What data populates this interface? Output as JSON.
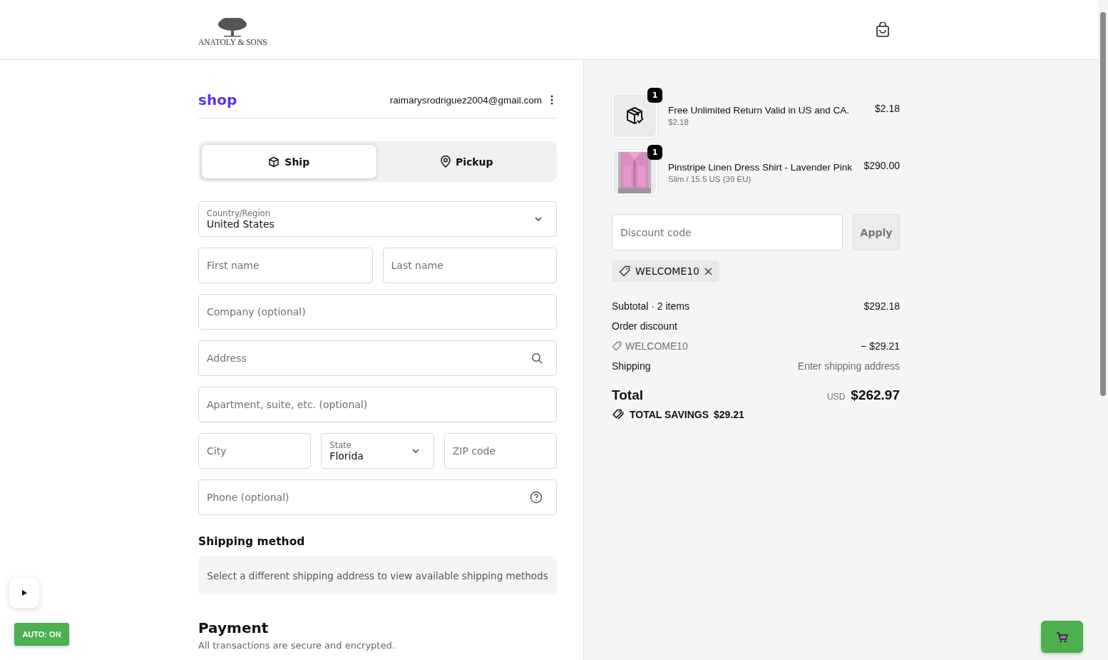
{
  "header": {
    "brand": "ANATOLY & SONS"
  },
  "account": {
    "logo": "shop",
    "email": "raimarysrodriguez2004@gmail.com"
  },
  "delivery_tabs": [
    {
      "label": "Ship",
      "kind": "ship",
      "selected": true
    },
    {
      "label": "Pickup",
      "kind": "pickup",
      "selected": false
    }
  ],
  "form_rows": [
    [
      {
        "kind": "select",
        "label": "Country/Region",
        "value": "United States"
      }
    ],
    [
      {
        "kind": "text",
        "placeholder": "First name"
      },
      {
        "kind": "text",
        "placeholder": "Last name"
      }
    ],
    [
      {
        "kind": "text",
        "placeholder": "Company (optional)"
      }
    ],
    [
      {
        "kind": "search",
        "placeholder": "Address"
      }
    ],
    [
      {
        "kind": "text",
        "placeholder": "Apartment, suite, etc. (optional)"
      }
    ],
    [
      {
        "kind": "text",
        "placeholder": "City"
      },
      {
        "kind": "select",
        "label": "State",
        "value": "Florida"
      },
      {
        "kind": "text",
        "placeholder": "ZIP code"
      }
    ],
    [
      {
        "kind": "help",
        "placeholder": "Phone (optional)"
      }
    ]
  ],
  "shipping_method": {
    "title": "Shipping method",
    "notice": "Select a different shipping address to view available shipping methods"
  },
  "payment": {
    "title": "Payment",
    "subtitle": "All transactions are secure and encrypted."
  },
  "cart_items": [
    {
      "kind": "icon",
      "name": "Free Unlimited Return Valid in US and CA.",
      "detail": "$2.18",
      "price": "$2.18",
      "quantity": "1"
    },
    {
      "kind": "picture",
      "name": "Pinstripe Linen Dress Shirt - Lavender Pink",
      "detail": "Slim / 15.5 US (39 EU)",
      "price": "$290.00",
      "quantity": "1"
    }
  ],
  "discount": {
    "placeholder": "Discount code",
    "button": "Apply",
    "applied_code": "WELCOME10"
  },
  "summary": {
    "subtotal_label": "Subtotal · 2 items",
    "subtotal": "$292.18",
    "discount_label": "Order discount",
    "discount_code": "WELCOME10",
    "discount_amount": "− $29.21",
    "shipping_label": "Shipping",
    "shipping_value": "Enter shipping address",
    "total_label": "Total",
    "currency": "USD",
    "total": "$262.97",
    "savings_label": "TOTAL SAVINGS",
    "savings": "$29.21"
  },
  "overlay": {
    "auto_label": "AUTO: ON"
  }
}
